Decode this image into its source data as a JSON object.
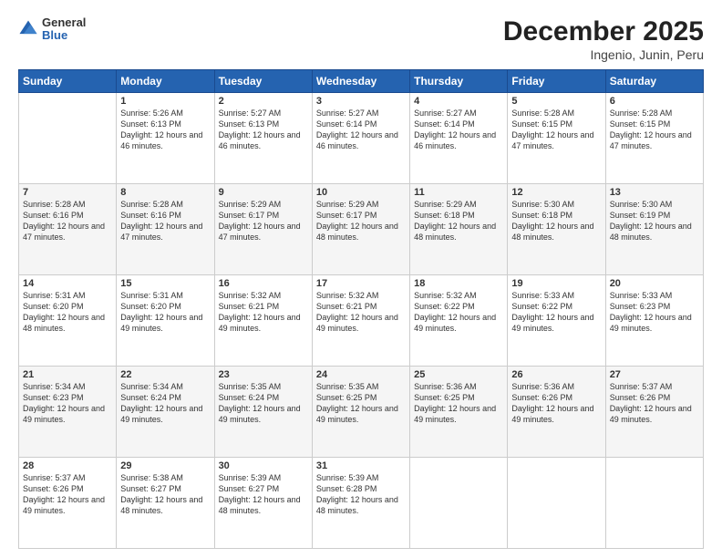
{
  "logo": {
    "general": "General",
    "blue": "Blue"
  },
  "title": "December 2025",
  "subtitle": "Ingenio, Junin, Peru",
  "days_header": [
    "Sunday",
    "Monday",
    "Tuesday",
    "Wednesday",
    "Thursday",
    "Friday",
    "Saturday"
  ],
  "weeks": [
    [
      {
        "day": "",
        "sunrise": "",
        "sunset": "",
        "daylight": ""
      },
      {
        "day": "1",
        "sunrise": "Sunrise: 5:26 AM",
        "sunset": "Sunset: 6:13 PM",
        "daylight": "Daylight: 12 hours and 46 minutes."
      },
      {
        "day": "2",
        "sunrise": "Sunrise: 5:27 AM",
        "sunset": "Sunset: 6:13 PM",
        "daylight": "Daylight: 12 hours and 46 minutes."
      },
      {
        "day": "3",
        "sunrise": "Sunrise: 5:27 AM",
        "sunset": "Sunset: 6:14 PM",
        "daylight": "Daylight: 12 hours and 46 minutes."
      },
      {
        "day": "4",
        "sunrise": "Sunrise: 5:27 AM",
        "sunset": "Sunset: 6:14 PM",
        "daylight": "Daylight: 12 hours and 46 minutes."
      },
      {
        "day": "5",
        "sunrise": "Sunrise: 5:28 AM",
        "sunset": "Sunset: 6:15 PM",
        "daylight": "Daylight: 12 hours and 47 minutes."
      },
      {
        "day": "6",
        "sunrise": "Sunrise: 5:28 AM",
        "sunset": "Sunset: 6:15 PM",
        "daylight": "Daylight: 12 hours and 47 minutes."
      }
    ],
    [
      {
        "day": "7",
        "sunrise": "Sunrise: 5:28 AM",
        "sunset": "Sunset: 6:16 PM",
        "daylight": "Daylight: 12 hours and 47 minutes."
      },
      {
        "day": "8",
        "sunrise": "Sunrise: 5:28 AM",
        "sunset": "Sunset: 6:16 PM",
        "daylight": "Daylight: 12 hours and 47 minutes."
      },
      {
        "day": "9",
        "sunrise": "Sunrise: 5:29 AM",
        "sunset": "Sunset: 6:17 PM",
        "daylight": "Daylight: 12 hours and 47 minutes."
      },
      {
        "day": "10",
        "sunrise": "Sunrise: 5:29 AM",
        "sunset": "Sunset: 6:17 PM",
        "daylight": "Daylight: 12 hours and 48 minutes."
      },
      {
        "day": "11",
        "sunrise": "Sunrise: 5:29 AM",
        "sunset": "Sunset: 6:18 PM",
        "daylight": "Daylight: 12 hours and 48 minutes."
      },
      {
        "day": "12",
        "sunrise": "Sunrise: 5:30 AM",
        "sunset": "Sunset: 6:18 PM",
        "daylight": "Daylight: 12 hours and 48 minutes."
      },
      {
        "day": "13",
        "sunrise": "Sunrise: 5:30 AM",
        "sunset": "Sunset: 6:19 PM",
        "daylight": "Daylight: 12 hours and 48 minutes."
      }
    ],
    [
      {
        "day": "14",
        "sunrise": "Sunrise: 5:31 AM",
        "sunset": "Sunset: 6:20 PM",
        "daylight": "Daylight: 12 hours and 48 minutes."
      },
      {
        "day": "15",
        "sunrise": "Sunrise: 5:31 AM",
        "sunset": "Sunset: 6:20 PM",
        "daylight": "Daylight: 12 hours and 49 minutes."
      },
      {
        "day": "16",
        "sunrise": "Sunrise: 5:32 AM",
        "sunset": "Sunset: 6:21 PM",
        "daylight": "Daylight: 12 hours and 49 minutes."
      },
      {
        "day": "17",
        "sunrise": "Sunrise: 5:32 AM",
        "sunset": "Sunset: 6:21 PM",
        "daylight": "Daylight: 12 hours and 49 minutes."
      },
      {
        "day": "18",
        "sunrise": "Sunrise: 5:32 AM",
        "sunset": "Sunset: 6:22 PM",
        "daylight": "Daylight: 12 hours and 49 minutes."
      },
      {
        "day": "19",
        "sunrise": "Sunrise: 5:33 AM",
        "sunset": "Sunset: 6:22 PM",
        "daylight": "Daylight: 12 hours and 49 minutes."
      },
      {
        "day": "20",
        "sunrise": "Sunrise: 5:33 AM",
        "sunset": "Sunset: 6:23 PM",
        "daylight": "Daylight: 12 hours and 49 minutes."
      }
    ],
    [
      {
        "day": "21",
        "sunrise": "Sunrise: 5:34 AM",
        "sunset": "Sunset: 6:23 PM",
        "daylight": "Daylight: 12 hours and 49 minutes."
      },
      {
        "day": "22",
        "sunrise": "Sunrise: 5:34 AM",
        "sunset": "Sunset: 6:24 PM",
        "daylight": "Daylight: 12 hours and 49 minutes."
      },
      {
        "day": "23",
        "sunrise": "Sunrise: 5:35 AM",
        "sunset": "Sunset: 6:24 PM",
        "daylight": "Daylight: 12 hours and 49 minutes."
      },
      {
        "day": "24",
        "sunrise": "Sunrise: 5:35 AM",
        "sunset": "Sunset: 6:25 PM",
        "daylight": "Daylight: 12 hours and 49 minutes."
      },
      {
        "day": "25",
        "sunrise": "Sunrise: 5:36 AM",
        "sunset": "Sunset: 6:25 PM",
        "daylight": "Daylight: 12 hours and 49 minutes."
      },
      {
        "day": "26",
        "sunrise": "Sunrise: 5:36 AM",
        "sunset": "Sunset: 6:26 PM",
        "daylight": "Daylight: 12 hours and 49 minutes."
      },
      {
        "day": "27",
        "sunrise": "Sunrise: 5:37 AM",
        "sunset": "Sunset: 6:26 PM",
        "daylight": "Daylight: 12 hours and 49 minutes."
      }
    ],
    [
      {
        "day": "28",
        "sunrise": "Sunrise: 5:37 AM",
        "sunset": "Sunset: 6:26 PM",
        "daylight": "Daylight: 12 hours and 49 minutes."
      },
      {
        "day": "29",
        "sunrise": "Sunrise: 5:38 AM",
        "sunset": "Sunset: 6:27 PM",
        "daylight": "Daylight: 12 hours and 48 minutes."
      },
      {
        "day": "30",
        "sunrise": "Sunrise: 5:39 AM",
        "sunset": "Sunset: 6:27 PM",
        "daylight": "Daylight: 12 hours and 48 minutes."
      },
      {
        "day": "31",
        "sunrise": "Sunrise: 5:39 AM",
        "sunset": "Sunset: 6:28 PM",
        "daylight": "Daylight: 12 hours and 48 minutes."
      },
      {
        "day": "",
        "sunrise": "",
        "sunset": "",
        "daylight": ""
      },
      {
        "day": "",
        "sunrise": "",
        "sunset": "",
        "daylight": ""
      },
      {
        "day": "",
        "sunrise": "",
        "sunset": "",
        "daylight": ""
      }
    ]
  ]
}
